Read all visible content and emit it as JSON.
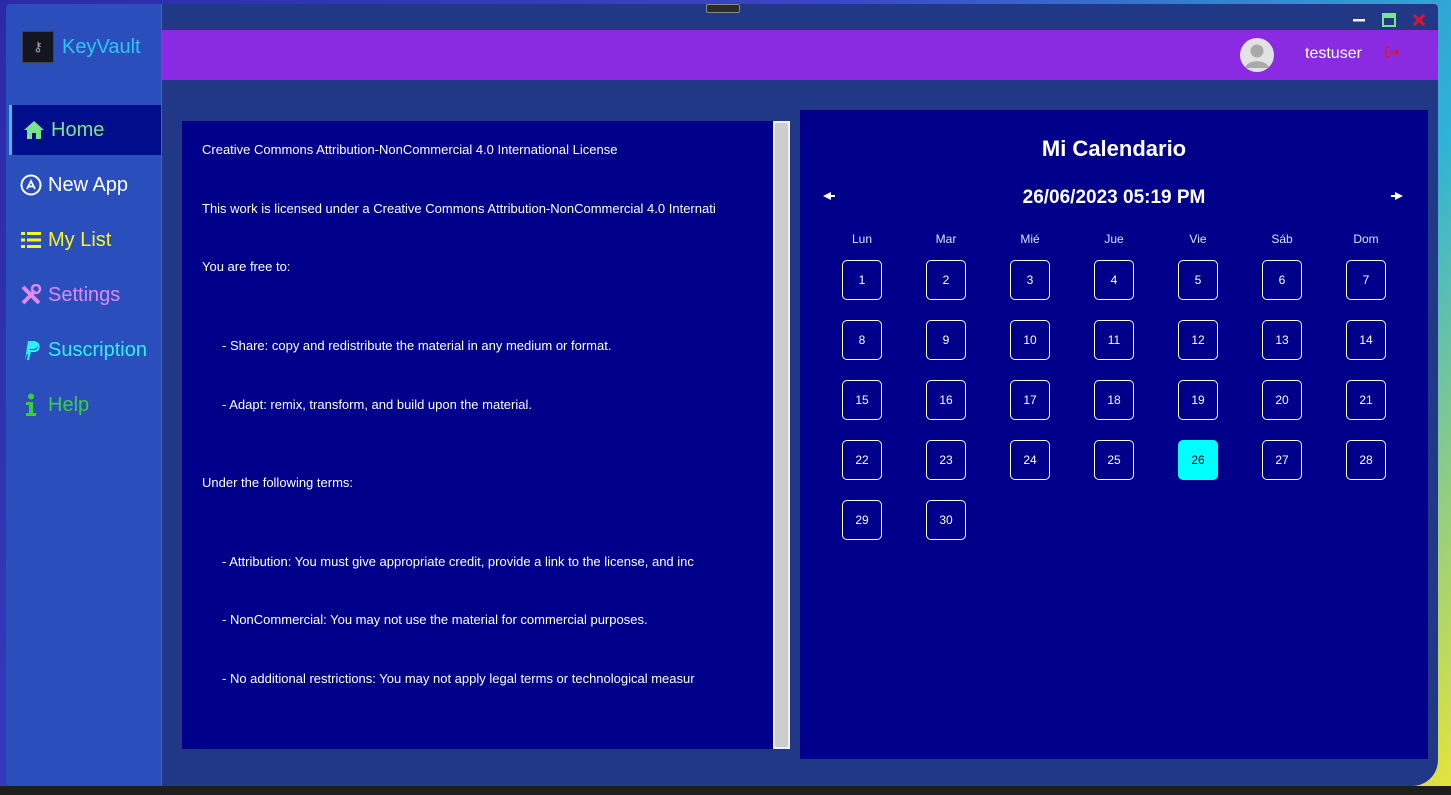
{
  "brand": {
    "name": "KeyVault",
    "logo_icon": "key-icon"
  },
  "sidebar": {
    "items": [
      {
        "label": "Home",
        "icon": "home-icon",
        "color": "#7be38b",
        "active": true
      },
      {
        "label": "New App",
        "icon": "app-store-icon",
        "color": "#ffffff"
      },
      {
        "label": "My List",
        "icon": "list-icon",
        "color": "#f5f520"
      },
      {
        "label": "Settings",
        "icon": "tools-icon",
        "color": "#e08af0"
      },
      {
        "label": "Suscription",
        "icon": "paypal-icon",
        "color": "#2ef0f0"
      },
      {
        "label": "Help",
        "icon": "info-icon",
        "color": "#3ccf3c"
      }
    ]
  },
  "header": {
    "username": "testuser",
    "accent": "#8a2be2",
    "logout_color": "#e0142c"
  },
  "window_controls": {
    "minimize_color": "#f0f0f0",
    "maximize_color": "#7be38b",
    "close_color": "#e0142c"
  },
  "license": {
    "lines": [
      "Creative Commons Attribution-NonCommercial 4.0 International License",
      "This work is licensed under a Creative Commons Attribution-NonCommercial 4.0 Internati",
      "You are free to:",
      "- Share: copy and redistribute the material in any medium or format.",
      "- Adapt: remix, transform, and build upon the material.",
      "Under the following terms:",
      "- Attribution: You must give appropriate credit, provide a link to the license, and inc",
      "- NonCommercial: You may not use the material for commercial purposes.",
      "- No additional restrictions: You may not apply legal terms or technological measur"
    ]
  },
  "calendar": {
    "title": "Mi Calendario",
    "current_datetime": "26/06/2023 05:19 PM",
    "weekdays": [
      "Lun",
      "Mar",
      "Mié",
      "Jue",
      "Vie",
      "Sáb",
      "Dom"
    ],
    "days": [
      "1",
      "2",
      "3",
      "4",
      "5",
      "6",
      "7",
      "8",
      "9",
      "10",
      "11",
      "12",
      "13",
      "14",
      "15",
      "16",
      "17",
      "18",
      "19",
      "20",
      "21",
      "22",
      "23",
      "24",
      "25",
      "26",
      "27",
      "28",
      "29",
      "30"
    ],
    "today": "26",
    "today_color": "#00ffff",
    "prev_icon": "prev-arrow-icon",
    "next_icon": "next-arrow-icon"
  }
}
